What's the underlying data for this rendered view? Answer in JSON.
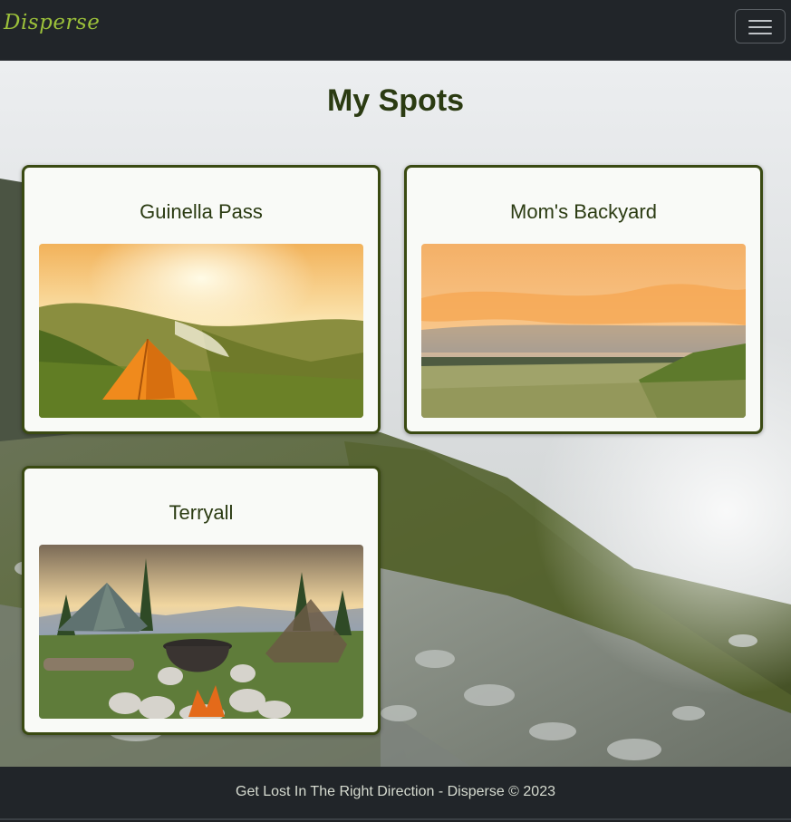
{
  "navbar": {
    "brand": "Disperse",
    "menu_icon": "hamburger-menu-icon",
    "brand_color": "#9cc13a"
  },
  "main": {
    "title": "My Spots",
    "spots": [
      {
        "name": "Guinella Pass",
        "image": "orange tent on grassy hill at sunrise over river valley"
      },
      {
        "name": "Mom's Backyard",
        "image": "orange sunset clouds over open plains"
      },
      {
        "name": "Terryall",
        "image": "tent and campfire with cooking pot in forest meadow"
      }
    ]
  },
  "footer": {
    "text": "Get Lost In The Right Direction - Disperse © 2023"
  },
  "colors": {
    "accent_dark_green": "#2b3b12",
    "card_border": "#3a4a12",
    "nav_background": "#212529"
  }
}
